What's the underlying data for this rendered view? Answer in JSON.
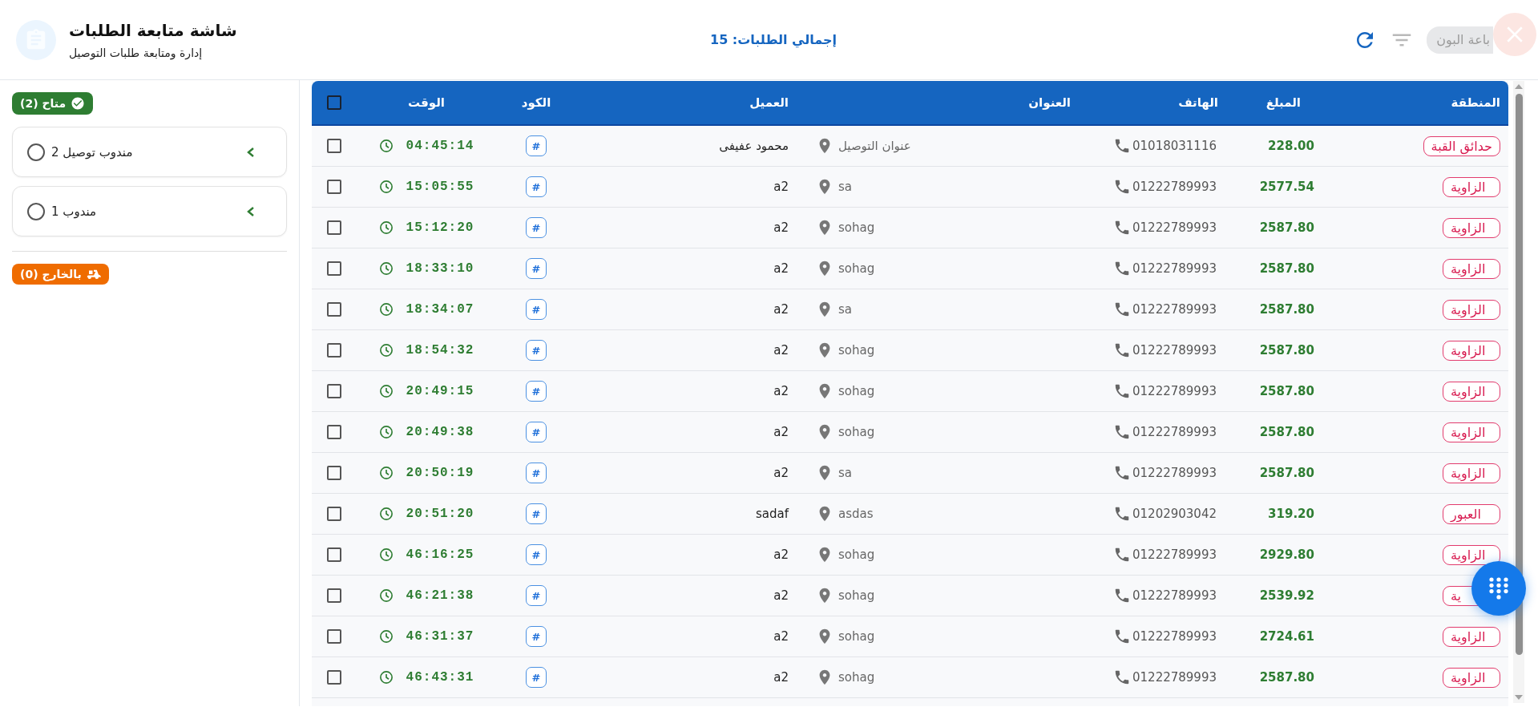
{
  "header": {
    "title": "شاشة متابعة الطلبات",
    "subtitle": "إدارة ومتابعة طلبات التوصيل",
    "total": "إجمالي الطلبات: 15",
    "print_button": "باعة البون"
  },
  "sidebar": {
    "available": {
      "label": "متاح (2)"
    },
    "agents": [
      {
        "name": "مندوب توصيل 2",
        "selected": false
      },
      {
        "name": "مندوب 1",
        "selected": false
      }
    ],
    "outside": {
      "label": "بالخارج (0)"
    }
  },
  "table": {
    "columns": [
      "المنطقة",
      "المبلغ",
      "الهاتف",
      "العنوان",
      "العميل",
      "الكود",
      "الوقت"
    ],
    "select_all_checked": false,
    "rows": [
      {
        "region": "حدائق القبة",
        "amount": "228.00",
        "phone": "01018031116",
        "address": "عنوان التوصيل",
        "client": "محمود عفيفى",
        "code": "#",
        "time": "04:45:14",
        "checked": false
      },
      {
        "region": "الزاوية",
        "amount": "2577.54",
        "phone": "01222789993",
        "address": "sa",
        "client": "a2",
        "code": "#",
        "time": "15:05:55",
        "checked": false
      },
      {
        "region": "الزاوية",
        "amount": "2587.80",
        "phone": "01222789993",
        "address": "sohag",
        "client": "a2",
        "code": "#",
        "time": "15:12:20",
        "checked": false
      },
      {
        "region": "الزاوية",
        "amount": "2587.80",
        "phone": "01222789993",
        "address": "sohag",
        "client": "a2",
        "code": "#",
        "time": "18:33:10",
        "checked": false
      },
      {
        "region": "الزاوية",
        "amount": "2587.80",
        "phone": "01222789993",
        "address": "sa",
        "client": "a2",
        "code": "#",
        "time": "18:34:07",
        "checked": false
      },
      {
        "region": "الزاوية",
        "amount": "2587.80",
        "phone": "01222789993",
        "address": "sohag",
        "client": "a2",
        "code": "#",
        "time": "18:54:32",
        "checked": false
      },
      {
        "region": "الزاوية",
        "amount": "2587.80",
        "phone": "01222789993",
        "address": "sohag",
        "client": "a2",
        "code": "#",
        "time": "20:49:15",
        "checked": false
      },
      {
        "region": "الزاوية",
        "amount": "2587.80",
        "phone": "01222789993",
        "address": "sohag",
        "client": "a2",
        "code": "#",
        "time": "20:49:38",
        "checked": false
      },
      {
        "region": "الزاوية",
        "amount": "2587.80",
        "phone": "01222789993",
        "address": "sa",
        "client": "a2",
        "code": "#",
        "time": "20:50:19",
        "checked": false
      },
      {
        "region": "العبور",
        "amount": "319.20",
        "phone": "01202903042",
        "address": "asdas",
        "client": "sadaf",
        "code": "#",
        "time": "20:51:20",
        "checked": false
      },
      {
        "region": "الزاوية",
        "amount": "2929.80",
        "phone": "01222789993",
        "address": "sohag",
        "client": "a2",
        "code": "#",
        "time": "46:16:25",
        "checked": false
      },
      {
        "region": "ية",
        "amount": "2539.92",
        "phone": "01222789993",
        "address": "sohag",
        "client": "a2",
        "code": "#",
        "time": "46:21:38",
        "checked": false
      },
      {
        "region": "الزاوية",
        "amount": "2724.61",
        "phone": "01222789993",
        "address": "sohag",
        "client": "a2",
        "code": "#",
        "time": "46:31:37",
        "checked": false
      },
      {
        "region": "الزاوية",
        "amount": "2587.80",
        "phone": "01222789993",
        "address": "sohag",
        "client": "a2",
        "code": "#",
        "time": "46:43:31",
        "checked": false
      }
    ]
  }
}
